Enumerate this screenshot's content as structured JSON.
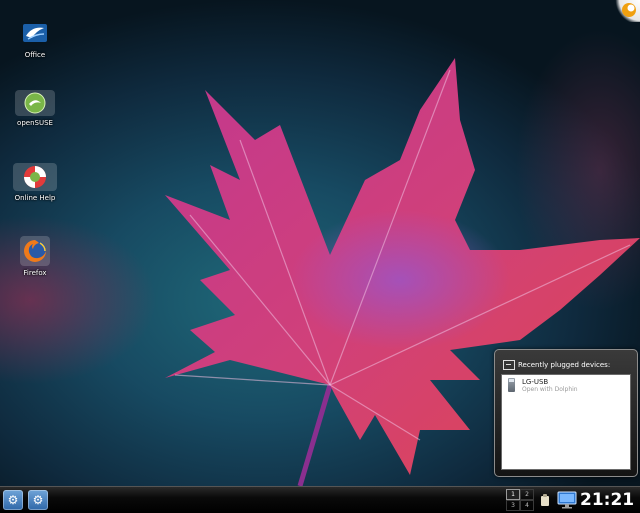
{
  "desktop": {
    "icons": [
      {
        "label": "Office"
      },
      {
        "label": "openSUSE"
      },
      {
        "label": "Online Help"
      },
      {
        "label": "Firefox"
      }
    ]
  },
  "device_notifier": {
    "title": "Recently plugged devices:",
    "devices": [
      {
        "name": "LG-USB",
        "action": "Open with Dolphin"
      }
    ]
  },
  "panel": {
    "pager": [
      "1",
      "2",
      "3",
      "4"
    ],
    "active_desktop": "1",
    "clock": "21:21"
  },
  "colors": {
    "accent": "#2f67a8",
    "panel": "#000000"
  }
}
